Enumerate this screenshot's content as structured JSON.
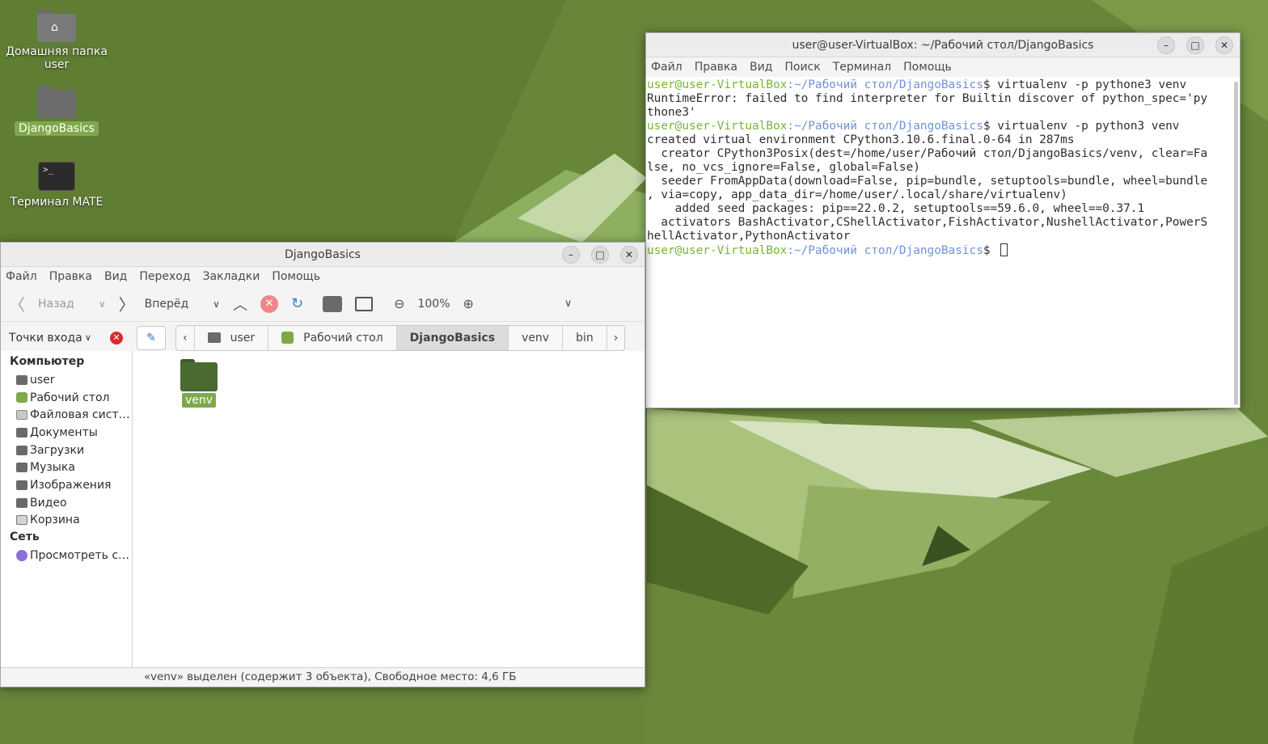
{
  "desktop": {
    "icons": [
      {
        "label": "Домашняя папка\nuser",
        "icon": "home-folder-icon"
      },
      {
        "label": "DjangoBasics",
        "icon": "folder-icon"
      },
      {
        "label": "Терминал MATE",
        "icon": "terminal-icon"
      }
    ]
  },
  "terminal": {
    "title": "user@user-VirtualBox: ~/Рабочий стол/DjangoBasics",
    "menu": [
      "Файл",
      "Правка",
      "Вид",
      "Поиск",
      "Терминал",
      "Помощь"
    ],
    "prompt_user": "user@user-VirtualBox",
    "prompt_path": ":~/Рабочий стол/DjangoBasics",
    "lines": [
      {
        "type": "prompt",
        "cmd": "$ virtualenv -p pythone3 venv"
      },
      {
        "type": "out",
        "text": "RuntimeError: failed to find interpreter for Builtin discover of python_spec='py"
      },
      {
        "type": "out",
        "text": "thone3'"
      },
      {
        "type": "prompt",
        "cmd": "$ virtualenv -p python3 venv"
      },
      {
        "type": "out",
        "text": "created virtual environment CPython3.10.6.final.0-64 in 287ms"
      },
      {
        "type": "out",
        "text": "  creator CPython3Posix(dest=/home/user/Рабочий стол/DjangoBasics/venv, clear=Fa"
      },
      {
        "type": "out",
        "text": "lse, no_vcs_ignore=False, global=False)"
      },
      {
        "type": "out",
        "text": "  seeder FromAppData(download=False, pip=bundle, setuptools=bundle, wheel=bundle"
      },
      {
        "type": "out",
        "text": ", via=copy, app_data_dir=/home/user/.local/share/virtualenv)"
      },
      {
        "type": "out",
        "text": "    added seed packages: pip==22.0.2, setuptools==59.6.0, wheel==0.37.1"
      },
      {
        "type": "out",
        "text": "  activators BashActivator,CShellActivator,FishActivator,NushellActivator,PowerS"
      },
      {
        "type": "out",
        "text": "hellActivator,PythonActivator"
      },
      {
        "type": "prompt",
        "cmd": "$ "
      }
    ]
  },
  "filemanager": {
    "title": "DjangoBasics",
    "menu": [
      "Файл",
      "Правка",
      "Вид",
      "Переход",
      "Закладки",
      "Помощь"
    ],
    "toolbar": {
      "back": "Назад",
      "forward": "Вперёд",
      "zoom": "100%"
    },
    "places_label": "Точки входа",
    "breadcrumbs": [
      {
        "label": "user",
        "icon": "folder-icon"
      },
      {
        "label": "Рабочий стол",
        "icon": "desktop-icon"
      },
      {
        "label": "DjangoBasics",
        "active": true
      },
      {
        "label": "venv"
      },
      {
        "label": "bin"
      }
    ],
    "sidebar": {
      "computer_head": "Компьютер",
      "computer_items": [
        {
          "label": "user",
          "kind": "folder"
        },
        {
          "label": "Рабочий стол",
          "kind": "desk"
        },
        {
          "label": "Файловая сист…",
          "kind": "disk"
        },
        {
          "label": "Документы",
          "kind": "folder"
        },
        {
          "label": "Загрузки",
          "kind": "folder"
        },
        {
          "label": "Музыка",
          "kind": "folder"
        },
        {
          "label": "Изображения",
          "kind": "folder"
        },
        {
          "label": "Видео",
          "kind": "folder"
        },
        {
          "label": "Корзина",
          "kind": "trash"
        }
      ],
      "network_head": "Сеть",
      "network_items": [
        {
          "label": "Просмотреть с…",
          "kind": "net"
        }
      ]
    },
    "files": [
      {
        "name": "venv",
        "selected": true
      }
    ],
    "status": "«venv» выделен (содержит 3 объекта), Свободное место: 4,6 ГБ"
  }
}
